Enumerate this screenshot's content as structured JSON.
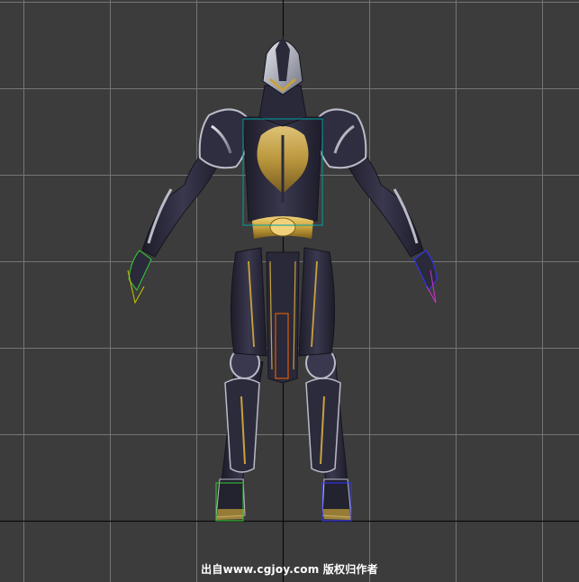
{
  "viewport": {
    "background_color": "#3c3c3c",
    "grid_line_color": "#7f7f7f",
    "axis_line_color": "#0a0a0a"
  },
  "model": {
    "armor_base_color": "#2b2a3b",
    "armor_trim_color": "#c9a23c",
    "silver_detail_color": "#b9bcc8",
    "bone_marker_colors": [
      "#33cc33",
      "#c8c800",
      "#3333ff",
      "#cc33cc",
      "#ff6600",
      "#00a0a0"
    ]
  },
  "watermark": {
    "text": "出自www.cgjoy.com 版权归作者"
  }
}
